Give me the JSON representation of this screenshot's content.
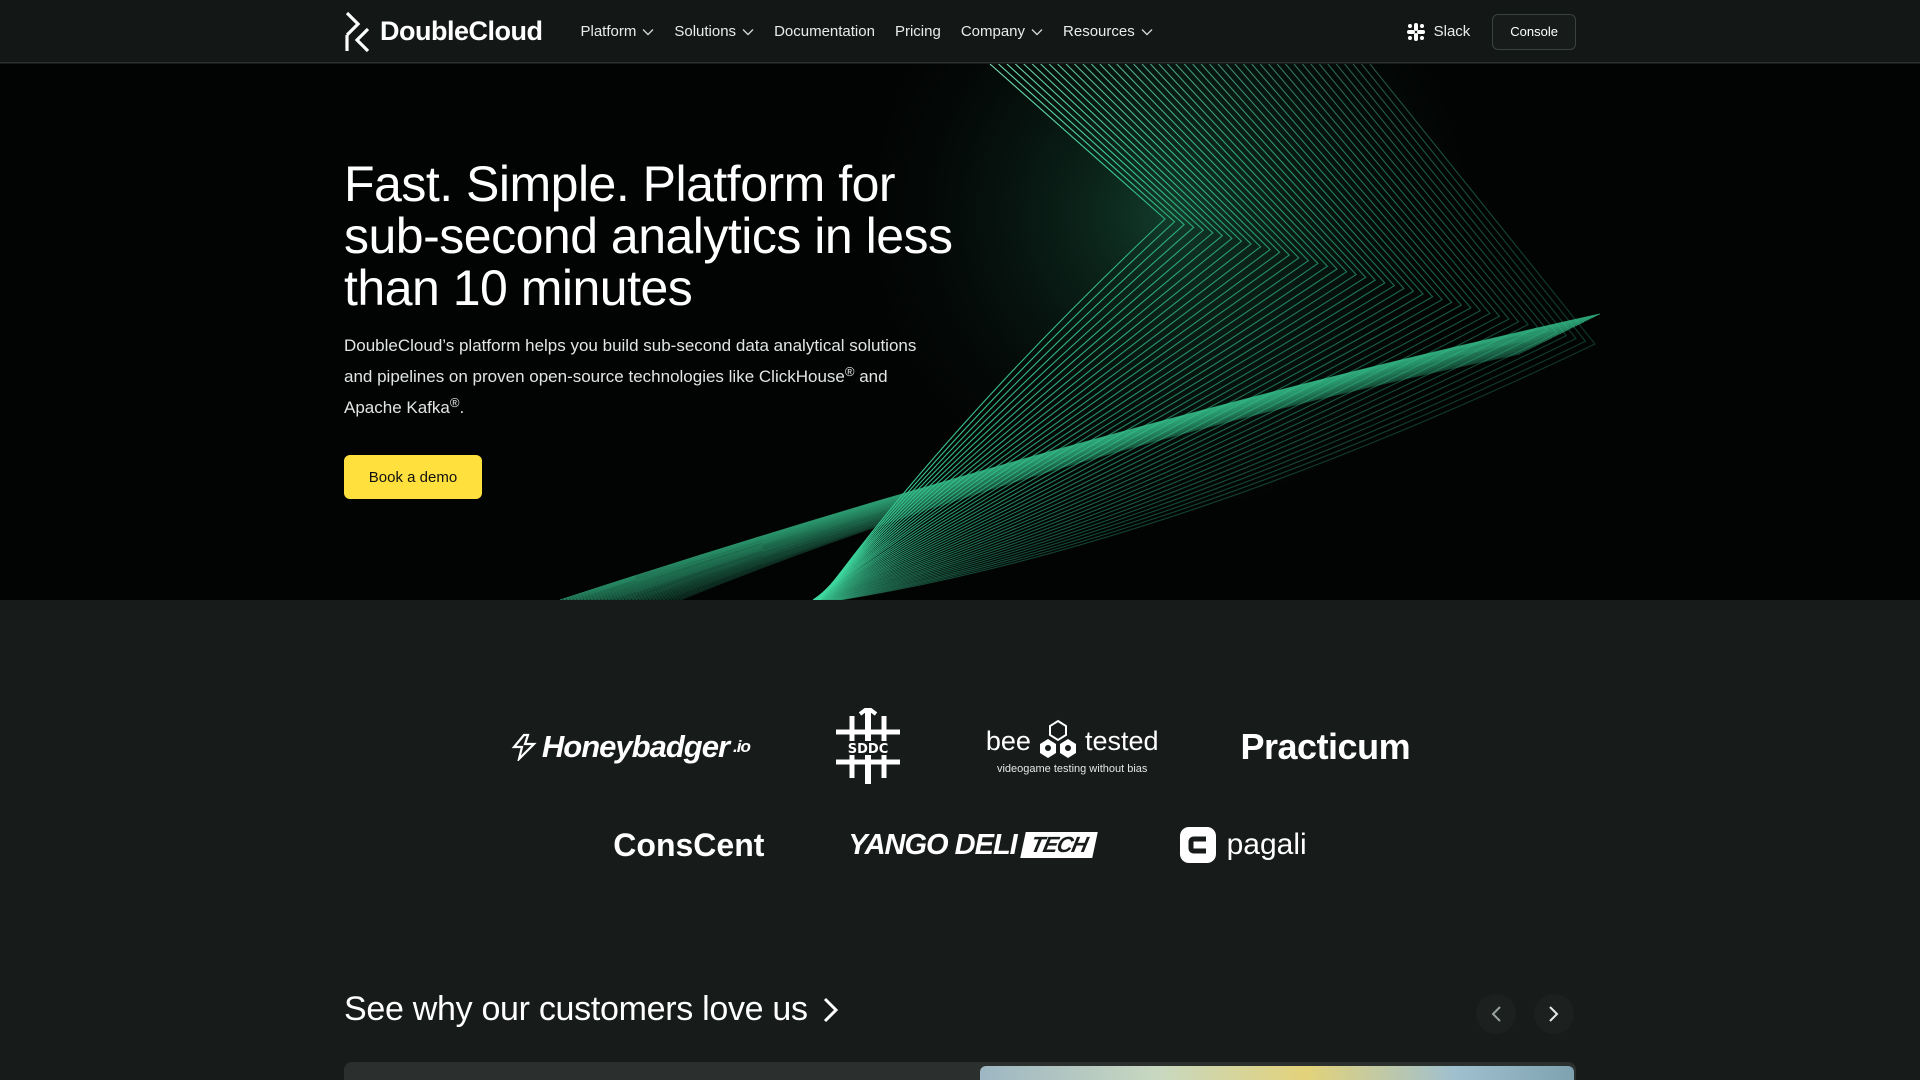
{
  "nav": {
    "brand": "DoubleCloud",
    "items": [
      {
        "label": "Platform",
        "has_dropdown": true
      },
      {
        "label": "Solutions",
        "has_dropdown": true
      },
      {
        "label": "Documentation",
        "has_dropdown": false
      },
      {
        "label": "Pricing",
        "has_dropdown": false
      },
      {
        "label": "Company",
        "has_dropdown": true
      },
      {
        "label": "Resources",
        "has_dropdown": true
      }
    ],
    "slack_label": "Slack",
    "console_label": "Console"
  },
  "hero": {
    "title": "Fast. Simple. Platform for\nsub-second analytics in less\nthan 10 minutes",
    "desc_part1": "DoubleCloud’s platform helps you build sub-second data analytical solutions and pipelines on proven open-source technologies like ClickHouse",
    "reg_mark": "®",
    "desc_part2": " and Apache Kafka",
    "desc_end": ".",
    "cta_label": "Book a demo",
    "accent_color": "#ffe03d",
    "art_color": "#3ed9a0"
  },
  "clients": {
    "honeybadger": "Honeybadger",
    "honeybadger_suffix": ".io",
    "sddc": "SDDC",
    "beetested_left": "bee",
    "beetested_right": "tested",
    "beetested_tagline": "videogame testing without bias",
    "practicum": "Practicum",
    "conscent": "ConsCent",
    "yango": "YANGO DELI",
    "yango_tech": "TECH",
    "pagali": "pagali"
  },
  "customers": {
    "title": "See why our customers love us",
    "prev_icon": "chevron-left-icon",
    "next_icon": "chevron-right-icon"
  }
}
